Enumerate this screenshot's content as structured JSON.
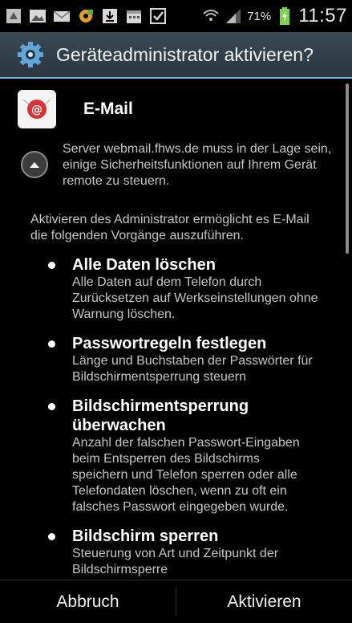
{
  "status_bar": {
    "battery_percent": "71%",
    "clock": "11:57",
    "icons": [
      "usb-icon",
      "gallery-icon",
      "email-icon",
      "settings-gear-icon",
      "download-icon",
      "calendar-icon",
      "checkbox-icon"
    ]
  },
  "dialog": {
    "title": "Geräteadministrator aktivieren?",
    "app_name": "E-Mail",
    "info_text": "Server webmail.fhws.de muss in der Lage sein, einige Sicherheitsfunktionen auf Ihrem Gerät remote zu steuern.",
    "intro_text": "Aktivieren des Administrator ermöglicht es E-Mail die folgenden Vorgänge auszuführen.",
    "policies": [
      {
        "title": "Alle Daten löschen",
        "description": "Alle Daten auf dem Telefon durch Zurücksetzen auf Werkseinstellungen ohne Warnung löschen."
      },
      {
        "title": "Passwortregeln festlegen",
        "description": "Länge und Buchstaben der Passwörter für Bildschirmentsperrung steuern"
      },
      {
        "title": "Bildschirmentsperrung überwachen",
        "description": "Anzahl der falschen Passwort-Eingaben beim Entsperren des Bildschirms speichern und Telefon sperren oder alle Telefondaten löschen, wenn zu oft ein falsches Passwort eingegeben wurde."
      },
      {
        "title": "Bildschirm sperren",
        "description": "Steuerung von Art und Zeitpunkt der Bildschirmsperre"
      }
    ]
  },
  "buttons": {
    "cancel_label": "Abbruch",
    "activate_label": "Aktivieren"
  },
  "colors": {
    "title_accent": "#6fb1d8",
    "email_icon_red": "#d9333a"
  }
}
